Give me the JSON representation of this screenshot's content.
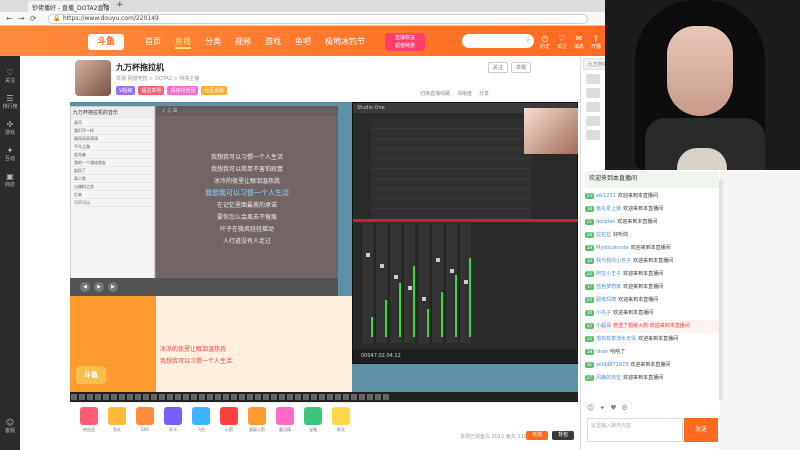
{
  "browser": {
    "tab_title": "钞佬播好 - 直播_DOTA2直播",
    "url": "https://www.douyu.com/220149",
    "newtab_symbol": "+"
  },
  "site": {
    "logo": "斗鱼",
    "nav": [
      "首页",
      "直播",
      "分类",
      "视频",
      "游戏",
      "鱼吧",
      "极地冰钓节"
    ],
    "active_nav": 1,
    "promo": "直播权益",
    "promo_sub": "超值特惠",
    "search_placeholder": "",
    "header_icons": [
      {
        "icon": "clock-icon",
        "label": "历史"
      },
      {
        "icon": "heart-icon",
        "label": "关注"
      },
      {
        "icon": "mail-icon",
        "label": "消息"
      },
      {
        "icon": "upload-icon",
        "label": "开播"
      }
    ]
  },
  "leftbar": [
    {
      "icon": "heart-icon",
      "label": "关注"
    },
    {
      "icon": "list-icon",
      "label": "排行榜"
    },
    {
      "icon": "game-icon",
      "label": "游戏"
    },
    {
      "icon": "gift-icon",
      "label": "互动"
    },
    {
      "icon": "shop-icon",
      "label": "商店"
    },
    {
      "icon": "user-icon",
      "label": "客服"
    }
  ],
  "host": {
    "name": "九万杯拖拉机",
    "meta": "举报  网游竞技 > DOTA2 > 特殊主播",
    "badges": [
      {
        "text": "V超级",
        "color": "#9b6dff"
      },
      {
        "text": "福星高照",
        "color": "#ff5d73"
      },
      {
        "text": "超级粉丝团",
        "color": "#ff6ac7"
      },
      {
        "text": "社区创新",
        "color": "#ffae35"
      }
    ],
    "right_buttons": [
      "关注",
      "举报"
    ],
    "tool_labels": [
      "切换直播线路",
      "清晰度",
      "分享"
    ]
  },
  "music": {
    "app_title": "九万杯拖拉机的音乐",
    "tracks": [
      "星河",
      "我们不一样",
      "情深深雨濛濛",
      "平凡之路",
      "追光者",
      "我的一个道姑朋友",
      "起风了",
      "离人愁",
      "山楂树之恋",
      "后来",
      "可不可以"
    ]
  },
  "lyrics": {
    "lines": [
      "我想我可以习惯一个人生活",
      "我想我可以简单不害怕寂寞",
      "冰冷的夜里让眼泪温热我",
      "我想我可以习惯一个人生活",
      "在记忆里面最美的承诺",
      "要你怎么会离去不留痕",
      "叶子在微风轻轻摇动",
      "人行道没有人走过"
    ],
    "highlight_index": 3
  },
  "daw": {
    "title": "Studio One",
    "time": "00047.02.04.12",
    "tracks": 8
  },
  "danmaku": {
    "lines": [
      "冰凉的夜里让眼泪温热我",
      "我想我可以习惯一个人生活"
    ]
  },
  "douyu_watermark": "斗鱼",
  "gifts": [
    {
      "label": "粉丝团",
      "color": "#ff5d73"
    },
    {
      "label": "鱼丸",
      "color": "#ffb837"
    },
    {
      "label": "666",
      "color": "#ff8c3a"
    },
    {
      "label": "办卡",
      "color": "#7a5cff"
    },
    {
      "label": "飞机",
      "color": "#3cb4ff"
    },
    {
      "label": "火箭",
      "color": "#ff4040"
    },
    {
      "label": "超级火箭",
      "color": "#ff9a2e"
    },
    {
      "label": "魔法棒",
      "color": "#ff6ac7"
    },
    {
      "label": "宝箱",
      "color": "#3cc47a"
    },
    {
      "label": "鲜花",
      "color": "#ffd84a"
    }
  ],
  "gift_footer": "本周已领鱼丸  2012",
  "gift_footer_count": "鱼丸 11887",
  "gift_buttons": [
    "充值",
    "背包"
  ],
  "chat": {
    "top_label": "九万杯拖拉机的直播间",
    "welcome": "欢迎来到本直播间",
    "messages": [
      {
        "lv": "23",
        "user": "wk1231",
        "text": "欢迎来到本直播间",
        "gift": false
      },
      {
        "lv": "18",
        "user": "鱼丸爱上我",
        "text": "欢迎来到本直播间",
        "gift": false
      },
      {
        "lv": "21",
        "user": "dotafan",
        "text": "欢迎来到本直播间",
        "gift": false
      },
      {
        "lv": "26",
        "user": "拉拉拉",
        "text": "好听的",
        "gift": false
      },
      {
        "lv": "19",
        "user": "Mysticalcode",
        "text": "欢迎来到本直播间",
        "gift": false
      },
      {
        "lv": "33",
        "user": "我与我的小日子",
        "text": "欢迎来到本直播间",
        "gift": false
      },
      {
        "lv": "22",
        "user": "阿宝小王子",
        "text": "欢迎来到本直播间",
        "gift": false
      },
      {
        "lv": "17",
        "user": "蓝色梦想家",
        "text": "欢迎来到本直播间",
        "gift": false
      },
      {
        "lv": "24",
        "user": "超级玛丽",
        "text": "欢迎来到本直播间",
        "gift": false
      },
      {
        "lv": "20",
        "user": "小丸子",
        "text": "欢迎来到本直播间",
        "gift": false
      },
      {
        "lv": "42",
        "user": "小超哥",
        "text": "赠送了超级火箭 欢迎来到本直播间",
        "gift": true
      },
      {
        "lv": "15",
        "user": "落花有意流水无情",
        "text": "欢迎来到本直播间",
        "gift": false
      },
      {
        "lv": "28",
        "user": "lihan",
        "text": "哈哈了",
        "gift": false
      },
      {
        "lv": "31",
        "user": "wildd871678",
        "text": "欢迎来到本直播间",
        "gift": false
      },
      {
        "lv": "27",
        "user": "风鹿的天空",
        "text": "欢迎来到本直播间",
        "gift": false
      }
    ],
    "input_placeholder": "这里输入聊天内容",
    "send_label": "发送"
  },
  "colors": {
    "accent": "#ff6a1f",
    "danmaku": "#ff3a3a"
  }
}
